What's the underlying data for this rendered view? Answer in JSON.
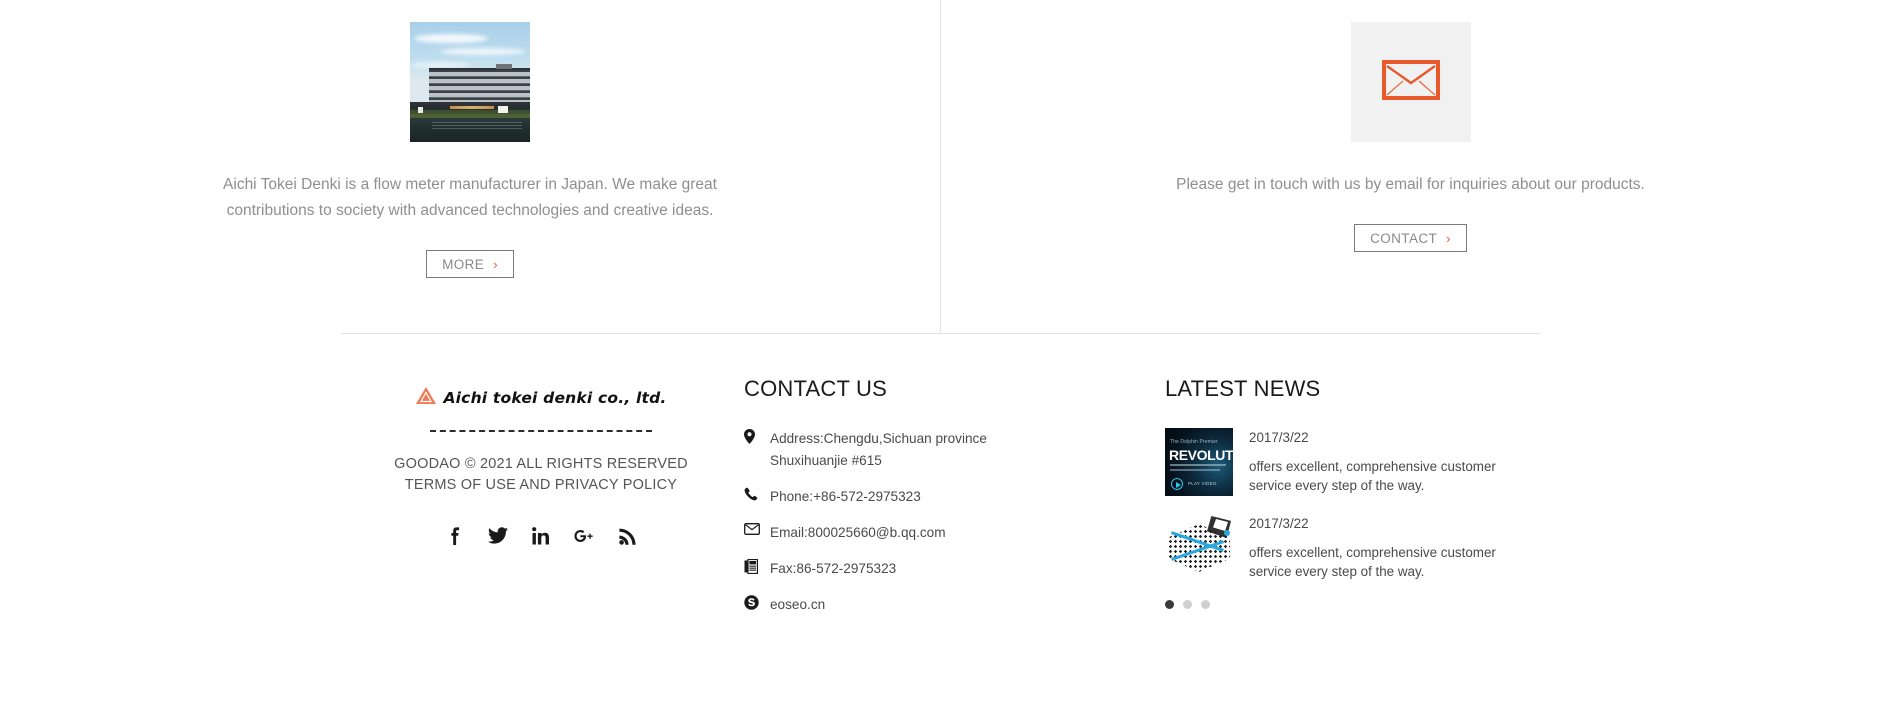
{
  "promo": {
    "left": {
      "media_icon": "company-building-photo",
      "text": "Aichi Tokei Denki is a flow meter manufacturer in Japan. We make great contributions to society with advanced technologies and creative ideas.",
      "button_label": "MORE",
      "button_chevron": "›"
    },
    "right": {
      "media_icon": "envelope-icon",
      "text": "Please get in touch with us by email for inquiries about our products.",
      "button_label": "CONTACT",
      "button_chevron": "›"
    }
  },
  "footer": {
    "brand": {
      "logo_icon": "aichi-triangle-logo",
      "logo_text": "Aichi tokei denki co., ltd.",
      "copyright_line1": "GOODAO © 2021 ALL RIGHTS RESERVED",
      "copyright_line2": "TERMS OF USE AND PRIVACY POLICY",
      "socials": [
        {
          "name": "facebook-icon",
          "glyph": "f"
        },
        {
          "name": "twitter-icon",
          "glyph": "twitter"
        },
        {
          "name": "linkedin-icon",
          "glyph": "in"
        },
        {
          "name": "googleplus-icon",
          "glyph": "G+"
        },
        {
          "name": "rss-icon",
          "glyph": "rss"
        }
      ]
    },
    "contact": {
      "title": "CONTACT US",
      "rows": [
        {
          "icon": "location-pin-icon",
          "line1": "Address:Chengdu,Sichuan province",
          "line2": "Shuxihuanjie #615"
        },
        {
          "icon": "phone-icon",
          "line1": "Phone:+86-572-2975323",
          "line2": ""
        },
        {
          "icon": "envelope-icon",
          "line1": "Email:800025660@b.qq.com",
          "line2": ""
        },
        {
          "icon": "fax-icon",
          "line1": "Fax:86-572-2975323",
          "line2": ""
        },
        {
          "icon": "skype-icon",
          "line1": "eoseo.cn",
          "line2": ""
        }
      ]
    },
    "news": {
      "title": "LATEST NEWS",
      "items": [
        {
          "thumb": "dolphin-premier-revolution-video-thumbnail",
          "thumb_text_small": "The Dolphin Premier",
          "thumb_text_big": "REVOLUTI",
          "thumb_play_label": "PLAY VIDEO",
          "date": "2017/3/22",
          "desc": "offers excellent, comprehensive customer service every step of the way."
        },
        {
          "thumb": "isometric-pool-cleaner-illustration-thumbnail",
          "thumb_text_small": "",
          "thumb_text_big": "",
          "thumb_play_label": "",
          "date": "2017/3/22",
          "desc": "offers excellent, comprehensive customer service every step of the way."
        }
      ],
      "pager": {
        "count": 3,
        "active_index": 0
      }
    }
  },
  "colors": {
    "accent_orange": "#e8582a",
    "logo_triangle": "#ef7a55",
    "body_text": "#4a4a4a",
    "muted_text": "#8f8f8f",
    "rule": "#e3e3e3"
  }
}
